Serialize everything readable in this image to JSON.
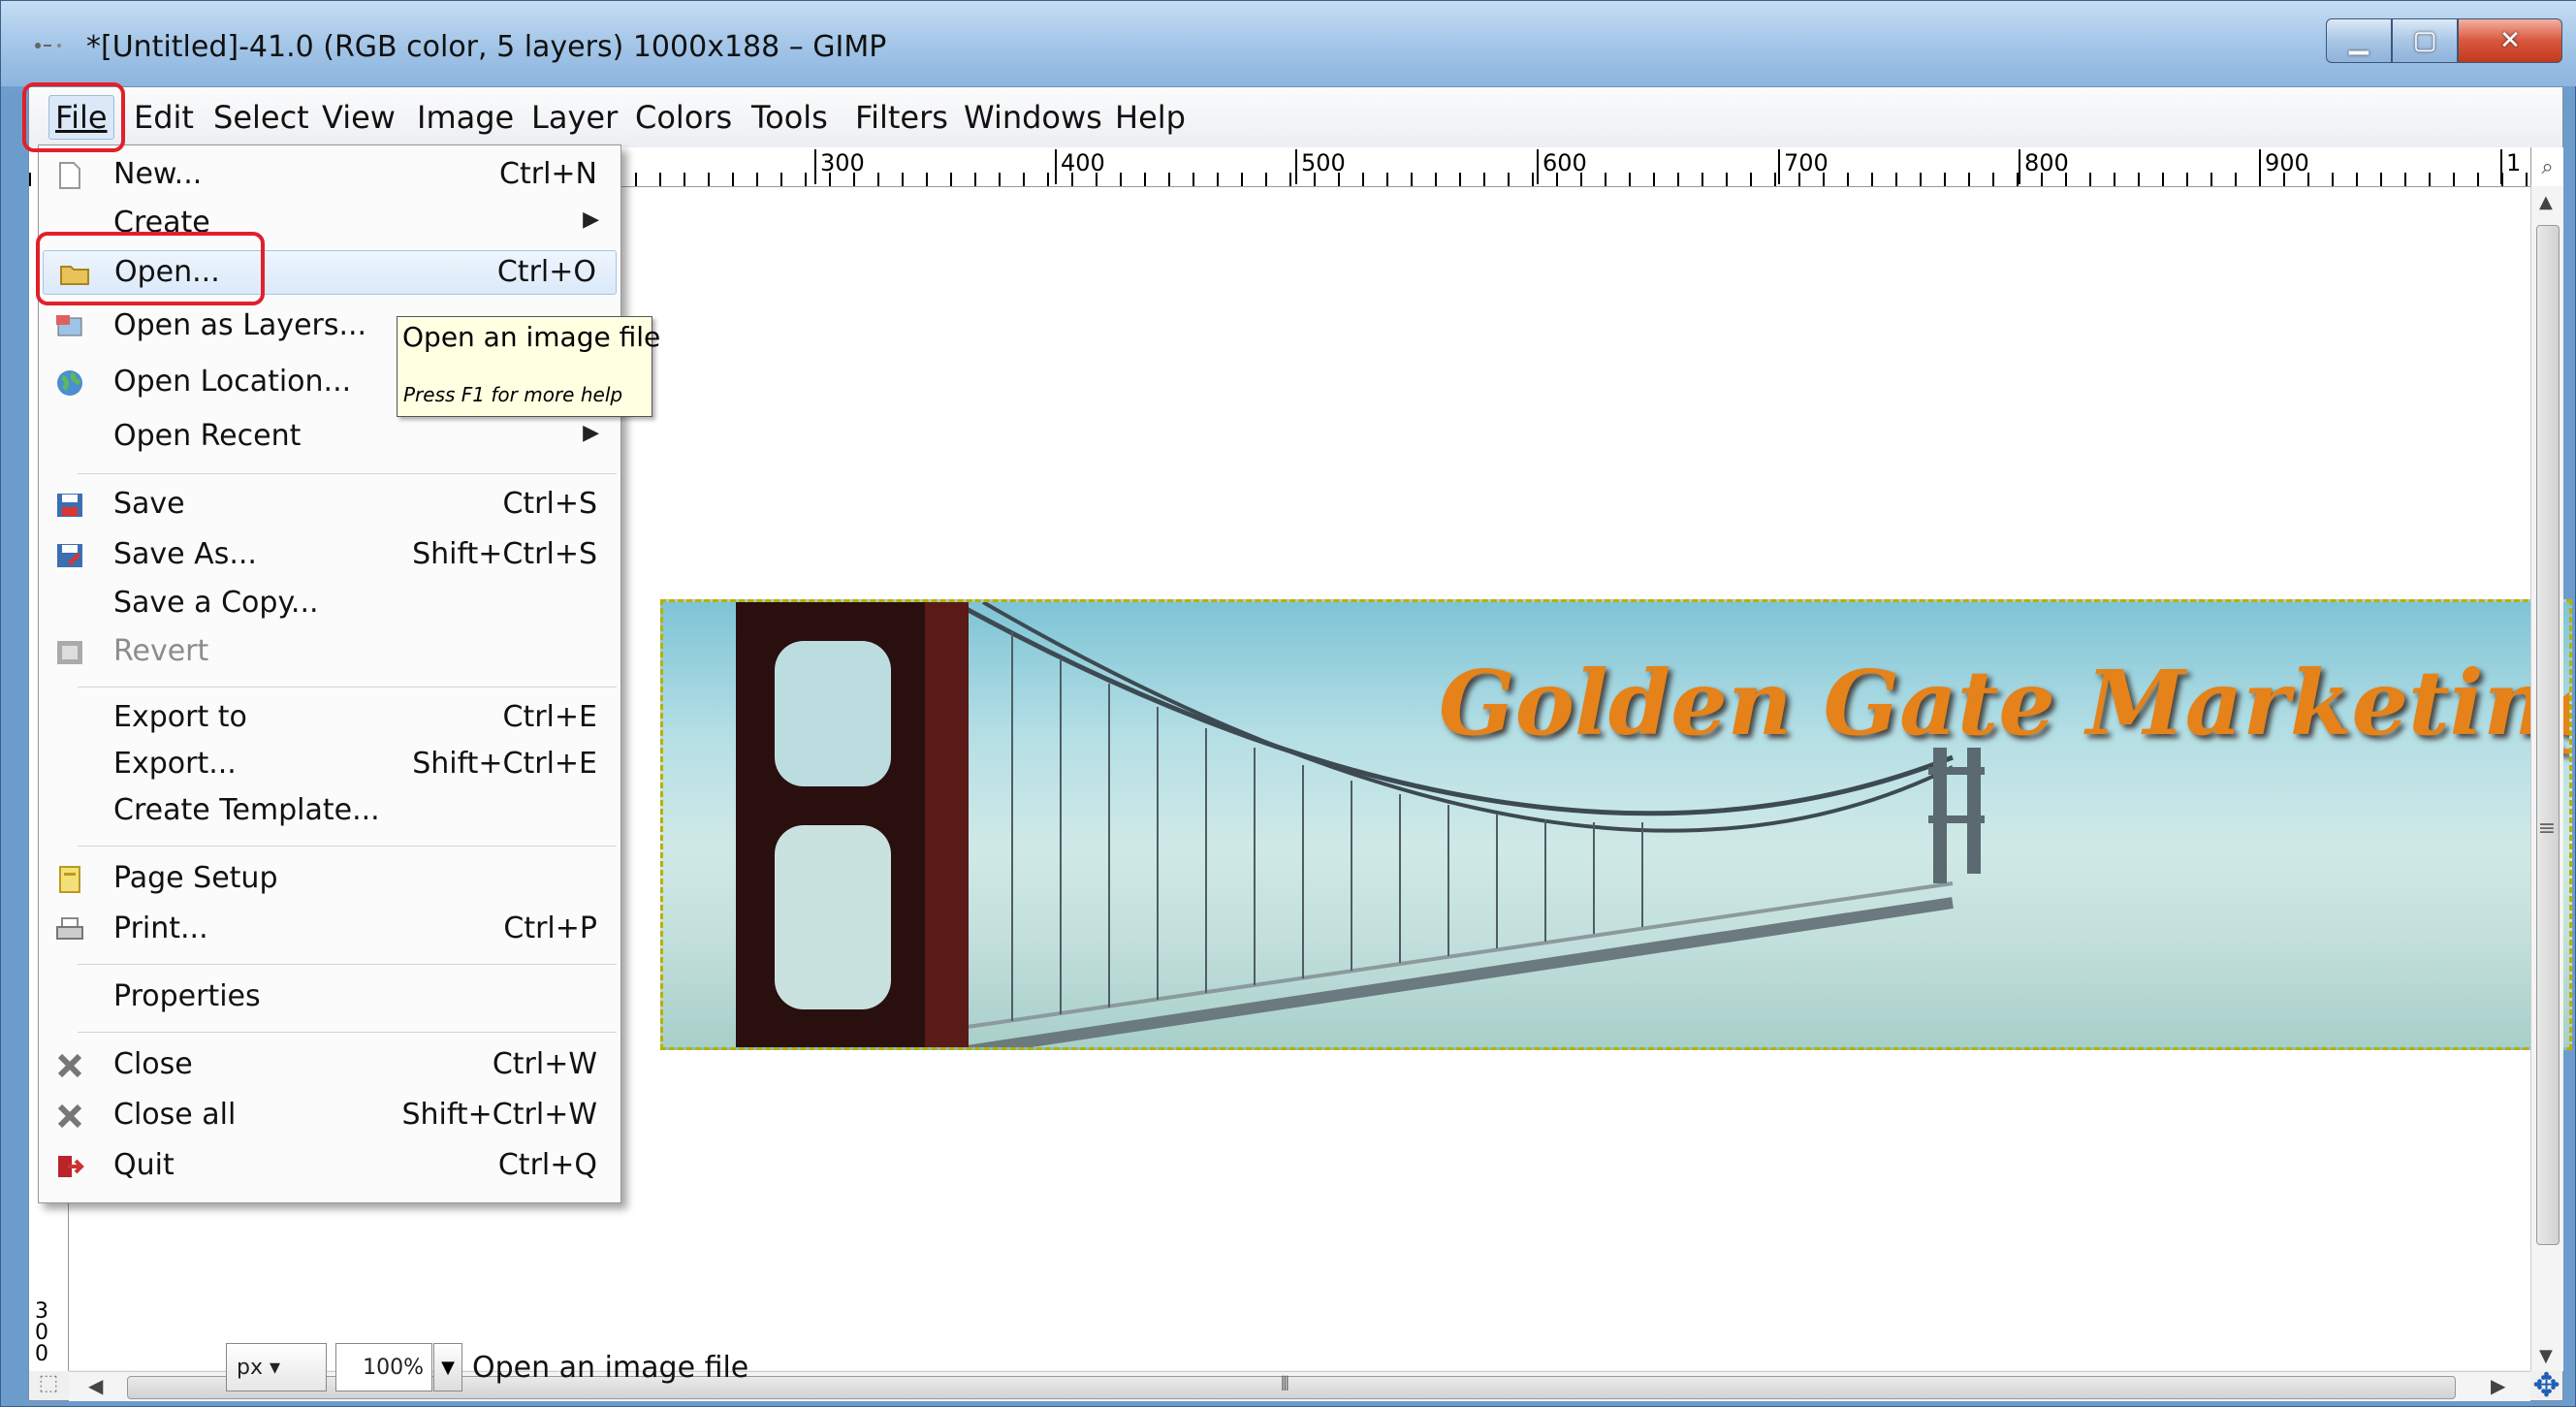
{
  "window": {
    "title": "*[Untitled]-41.0 (RGB color, 5 layers) 1000x188 – GIMP",
    "minimize": "▁",
    "maximize": "▢",
    "close": "✕"
  },
  "menubar": {
    "items": [
      "File",
      "Edit",
      "Select",
      "View",
      "Image",
      "Layer",
      "Colors",
      "Tools",
      "Filters",
      "Windows",
      "Help"
    ]
  },
  "ruler": {
    "top_labels": [
      "300",
      "400",
      "500",
      "600",
      "700",
      "800",
      "900",
      "1"
    ],
    "left_label": "300"
  },
  "file_menu": {
    "items": [
      {
        "label": "New...",
        "shortcut": "Ctrl+N",
        "icon": "new-file-icon"
      },
      {
        "label": "Create",
        "shortcut": "",
        "submenu": "▶"
      },
      {
        "label": "Open...",
        "shortcut": "Ctrl+O",
        "icon": "folder-icon",
        "highlighted": true
      },
      {
        "label": "Open as Layers...",
        "shortcut": "",
        "icon": "layers-icon"
      },
      {
        "label": "Open Location...",
        "shortcut": "",
        "icon": "globe-icon"
      },
      {
        "label": "Open Recent",
        "shortcut": "",
        "submenu": "▶"
      },
      {
        "label": "Save",
        "shortcut": "Ctrl+S",
        "icon": "save-icon"
      },
      {
        "label": "Save As...",
        "shortcut": "Shift+Ctrl+S",
        "icon": "save-as-icon"
      },
      {
        "label": "Save a Copy...",
        "shortcut": ""
      },
      {
        "label": "Revert",
        "shortcut": "",
        "icon": "revert-icon",
        "disabled": true
      },
      {
        "label": "Export to",
        "shortcut": "Ctrl+E"
      },
      {
        "label": "Export...",
        "shortcut": "Shift+Ctrl+E"
      },
      {
        "label": "Create Template...",
        "shortcut": ""
      },
      {
        "label": "Page Setup",
        "shortcut": "",
        "icon": "page-setup-icon"
      },
      {
        "label": "Print...",
        "shortcut": "Ctrl+P",
        "icon": "printer-icon"
      },
      {
        "label": "Properties",
        "shortcut": ""
      },
      {
        "label": "Close",
        "shortcut": "Ctrl+W",
        "icon": "close-x-icon"
      },
      {
        "label": "Close all",
        "shortcut": "Shift+Ctrl+W",
        "icon": "close-all-icon"
      },
      {
        "label": "Quit",
        "shortcut": "Ctrl+Q",
        "icon": "quit-icon"
      }
    ]
  },
  "tooltip": {
    "title": "Open an image file",
    "hint": "Press F1 for more help"
  },
  "canvas": {
    "banner_text": "Golden Gate Marketing"
  },
  "statusbar": {
    "unit": "px",
    "zoom": "100%",
    "message": "Open an image file"
  },
  "colors": {
    "highlight_annotation": "#e0202a",
    "banner_text": "#e58219",
    "tooltip_bg": "#ffffe1"
  }
}
